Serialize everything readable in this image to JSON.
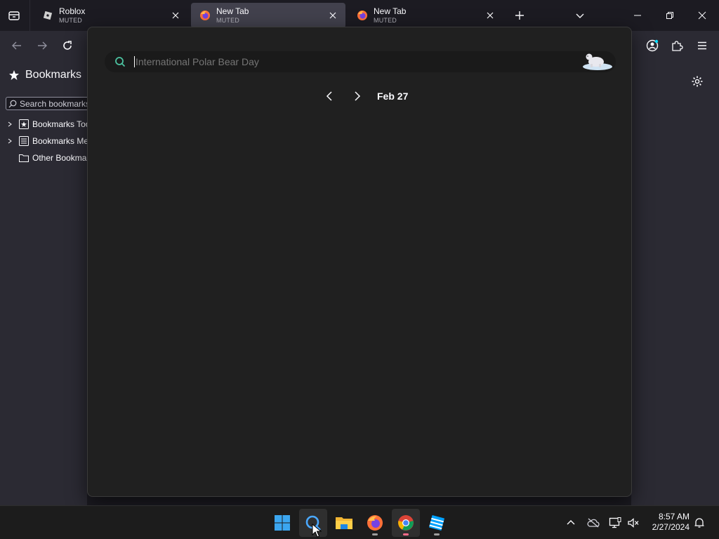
{
  "tabs": [
    {
      "title": "Roblox",
      "status": "MUTED",
      "icon": "roblox-icon"
    },
    {
      "title": "New Tab",
      "status": "MUTED",
      "icon": "firefox-icon",
      "active": true
    },
    {
      "title": "New Tab",
      "status": "MUTED",
      "icon": "firefox-icon"
    }
  ],
  "sidebar": {
    "title": "Bookmarks",
    "search_placeholder": "Search bookmarks",
    "items": [
      {
        "label": "Bookmarks Toolbar"
      },
      {
        "label": "Bookmarks Menu"
      },
      {
        "label": "Other Bookmarks"
      }
    ]
  },
  "search_panel": {
    "query": "International Polar Bear Day",
    "date": "Feb 27"
  },
  "taskbar": {
    "apps": [
      "start-icon",
      "search-icon",
      "file-explorer-icon",
      "firefox-icon",
      "chrome-icon",
      "roblox-studio-icon"
    ],
    "time": "8:57 AM",
    "date": "2/27/2024"
  },
  "colors": {
    "tab_bar": "#1c1b22",
    "toolbar": "#2b2a33",
    "active_tab": "#42414d",
    "panel": "#202020",
    "search_accent": "#4cc2a0"
  }
}
